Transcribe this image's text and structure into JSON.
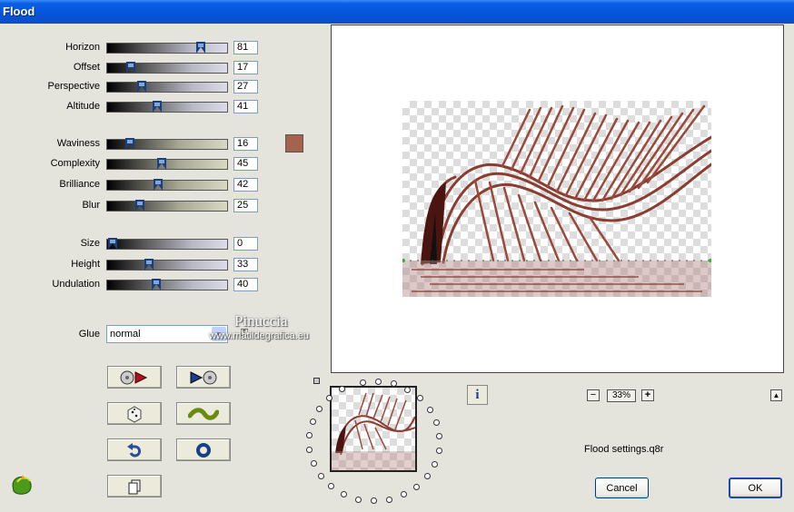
{
  "window": {
    "title": "Flood"
  },
  "params_group1": [
    {
      "label": "Horizon",
      "value": "81",
      "frac": 0.81
    },
    {
      "label": "Offset",
      "value": "17",
      "frac": 0.17
    },
    {
      "label": "Perspective",
      "value": "27",
      "frac": 0.27
    },
    {
      "label": "Altitude",
      "value": "41",
      "frac": 0.41
    }
  ],
  "params_group2": [
    {
      "label": "Waviness",
      "value": "16",
      "frac": 0.16
    },
    {
      "label": "Complexity",
      "value": "45",
      "frac": 0.45
    },
    {
      "label": "Brilliance",
      "value": "42",
      "frac": 0.42
    },
    {
      "label": "Blur",
      "value": "25",
      "frac": 0.25
    }
  ],
  "params_group3": [
    {
      "label": "Size",
      "value": "0",
      "frac": 0.0
    },
    {
      "label": "Height",
      "value": "33",
      "frac": 0.33
    },
    {
      "label": "Undulation",
      "value": "40",
      "frac": 0.4
    }
  ],
  "color_swatch": "#a5634e",
  "glue": {
    "label": "Glue",
    "value": "normal"
  },
  "watermark": {
    "name": "Pinuccia",
    "url": "www.matildegrafica.eu"
  },
  "zoom": {
    "level": "33%"
  },
  "settings_file": "Flood settings.q8r",
  "buttons": {
    "cancel": "Cancel",
    "ok": "OK"
  },
  "colors": {
    "titlebar": "#0553d8",
    "dialog_bg": "#e4e3dc",
    "ribbon": "#8a3e32"
  }
}
